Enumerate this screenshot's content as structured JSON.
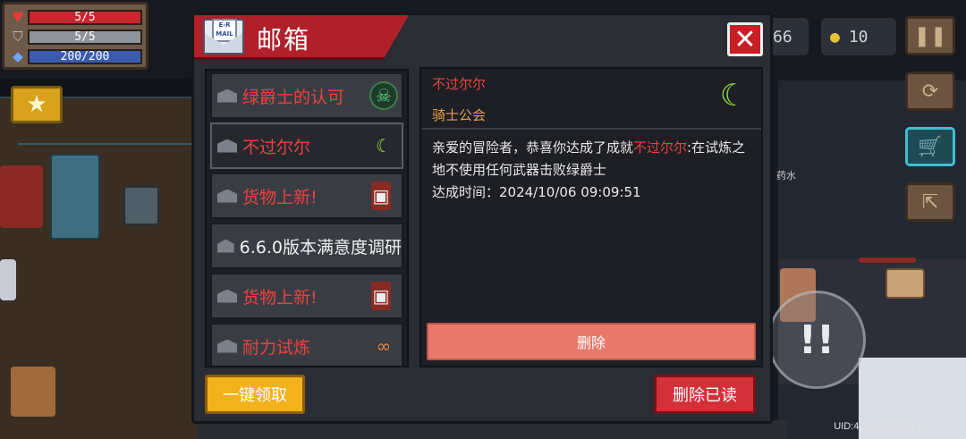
{
  "hud": {
    "health": "5/5",
    "armor": "5/5",
    "energy": "200/200",
    "health_fraction": 1.0,
    "armor_fraction": 1.0,
    "energy_fraction": 1.0,
    "gems": "66",
    "coins": "10",
    "uid": "UID:42763792 6.6.1.22",
    "potion_label": "药水"
  },
  "mailbox": {
    "title": "邮箱",
    "envelope_text": "E-R\nMAIL",
    "close_symbol": "✕",
    "items": [
      {
        "title": "绿爵士的认可",
        "style": "red",
        "icon": "green-knight-icon"
      },
      {
        "title": "不过尔尔",
        "style": "red",
        "icon": "green-moon-icon"
      },
      {
        "title": "货物上新!",
        "style": "red",
        "icon": "merchant-icon"
      },
      {
        "title": "6.6.0版本满意度调研",
        "style": "white",
        "icon": ""
      },
      {
        "title": "货物上新!",
        "style": "red",
        "icon": "merchant-icon"
      },
      {
        "title": "耐力试炼",
        "style": "red",
        "icon": "goggles-icon"
      }
    ],
    "detail": {
      "subject": "不过尔尔",
      "sender": "骑士公会",
      "body_prefix": "亲爱的冒险者，恭喜你达成了成就",
      "body_highlight": "不过尔尔",
      "body_suffix": ":在试炼之地不使用任何武器击败绿爵士",
      "time_line": "达成时间：2024/10/06 09:09:51",
      "delete_label": "删除"
    },
    "claim_all_label": "一键领取",
    "delete_read_label": "删除已读"
  },
  "colors": {
    "accent_red": "#b0202a",
    "highlight_red": "#e8433f",
    "sender_orange": "#e9a04a",
    "claim_yellow": "#f2b21e",
    "delete_salmon": "#e8786a"
  }
}
